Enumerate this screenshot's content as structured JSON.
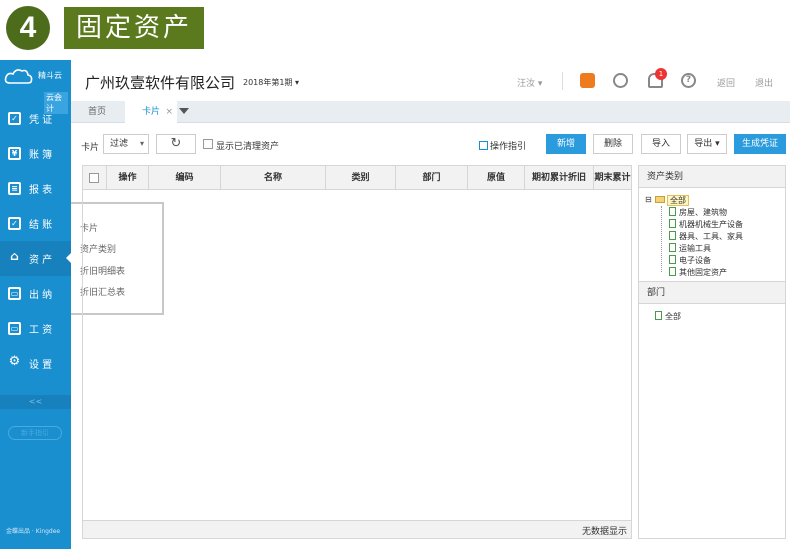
{
  "banner": {
    "number": "4",
    "title": "固定资产"
  },
  "sidebar": {
    "logo_text": "精斗云",
    "logo_sub": "云会计",
    "items": [
      {
        "label": "凭 证",
        "icon": "voucher-icon"
      },
      {
        "label": "账 簿",
        "icon": "ledger-icon"
      },
      {
        "label": "报 表",
        "icon": "report-icon"
      },
      {
        "label": "结 账",
        "icon": "checkout-icon"
      },
      {
        "label": "资 产",
        "icon": "asset-icon"
      },
      {
        "label": "出 纳",
        "icon": "cashier-icon"
      },
      {
        "label": "工 资",
        "icon": "salary-icon"
      },
      {
        "label": "设 置",
        "icon": "settings-icon"
      }
    ],
    "collapse": "<<",
    "new_version": "新手指引",
    "brand": "金蝶出品 · Kingdee"
  },
  "submenu": [
    "卡片",
    "资产类别",
    "折旧明细表",
    "折旧汇总表"
  ],
  "topbar": {
    "company": "广州玖壹软件有限公司",
    "period": "2018年第1期",
    "user": "汪汝",
    "badge": "1",
    "back": "返回",
    "logout": "退出"
  },
  "tabs": {
    "home": "首页",
    "active": "卡片",
    "close": "×"
  },
  "toolbar": {
    "label": "卡片",
    "filter": "过滤",
    "refresh": "↻",
    "show_cleared": "显示已清理资产",
    "guide": "操作指引",
    "add": "新增",
    "delete": "删除",
    "import": "导入",
    "export": "导出",
    "generate": "生成凭证"
  },
  "table": {
    "columns": [
      "操作",
      "编码",
      "名称",
      "类别",
      "部门",
      "原值",
      "期初累计折旧",
      "期末累计"
    ],
    "empty": "无数据显示"
  },
  "asset_panel": {
    "title": "资产类别",
    "root": "全部",
    "children": [
      "房屋、建筑物",
      "机器机械生产设备",
      "器具、工具、家具",
      "运输工具",
      "电子设备",
      "其他固定资产"
    ]
  },
  "dept_panel": {
    "title": "部门",
    "root": "全部"
  },
  "colors": {
    "sidebar": "#1a8fd0",
    "primary": "#2a9bdd",
    "banner": "#5a7a1d"
  }
}
